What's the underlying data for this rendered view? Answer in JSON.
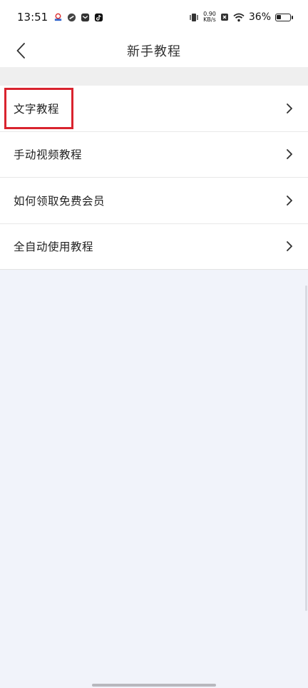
{
  "status_bar": {
    "time": "13:51",
    "net_speed_value": "0.90",
    "net_speed_unit": "KB/s",
    "battery_percent": "36%",
    "battery_level": 0.36
  },
  "header": {
    "title": "新手教程"
  },
  "menu": {
    "items": [
      {
        "label": "文字教程"
      },
      {
        "label": "手动视频教程"
      },
      {
        "label": "如何领取免费会员"
      },
      {
        "label": "全自动使用教程"
      }
    ]
  },
  "colors": {
    "highlight": "#d9232e",
    "background": "#f1f3fa"
  }
}
